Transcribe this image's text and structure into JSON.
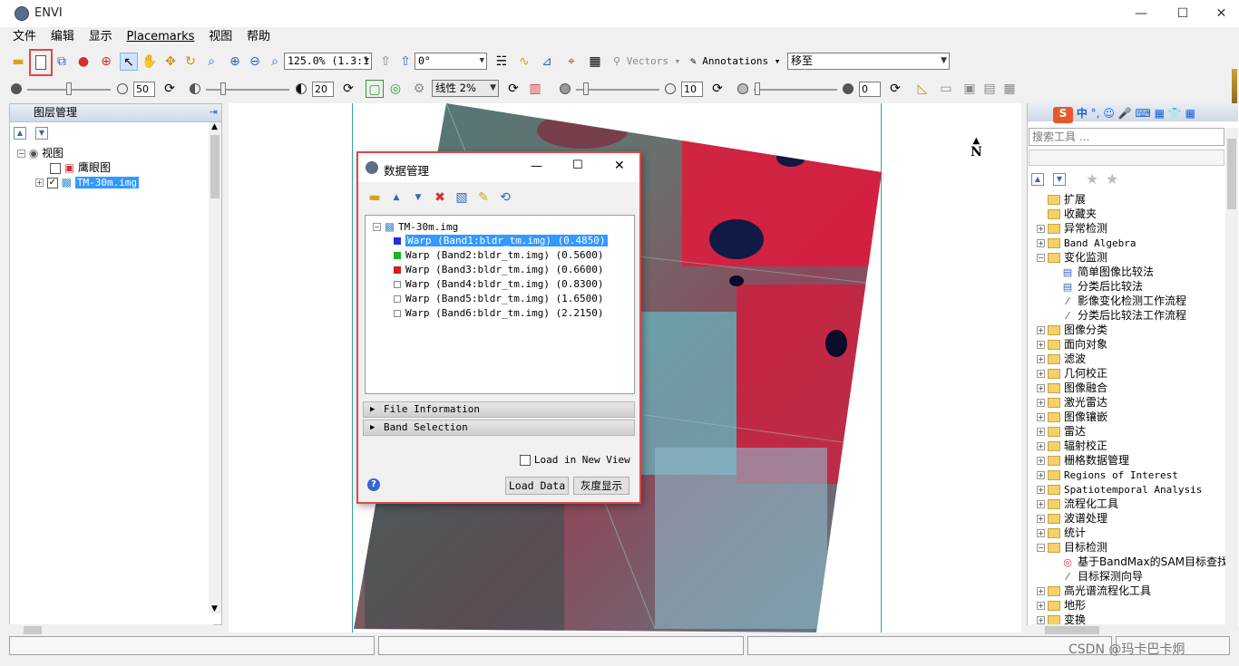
{
  "window": {
    "title": "ENVI"
  },
  "menu": [
    "文件",
    "编辑",
    "显示",
    "Placemarks",
    "视图",
    "帮助"
  ],
  "toolbar": {
    "zoom_value": "125.0% (1.3:1",
    "rotation_value": "0°",
    "vectors_label": "Vectors",
    "annotations_label": "Annotations",
    "goto_value": "移至"
  },
  "toolbar2": {
    "brightness": "50",
    "contrast": "20",
    "stretch": "线性 2%",
    "sharpen": "10",
    "transparency": "0"
  },
  "layer_panel": {
    "title": "图层管理",
    "root": "视图",
    "items": [
      {
        "label": "鹰眼图",
        "checked": false
      },
      {
        "label": "TM-30m.img",
        "checked": true,
        "selected": true
      }
    ]
  },
  "data_manager": {
    "title": "数据管理",
    "file": "TM-30m.img",
    "bands": [
      {
        "label": "Warp (Band1:bldr_tm.img) (0.4850)",
        "color": "#2a2ae0",
        "selected": true
      },
      {
        "label": "Warp (Band2:bldr_tm.img) (0.5600)",
        "color": "#1db51d"
      },
      {
        "label": "Warp (Band3:bldr_tm.img) (0.6600)",
        "color": "#d41c1c"
      },
      {
        "label": "Warp (Band4:bldr_tm.img) (0.8300)",
        "color": "#ffffff"
      },
      {
        "label": "Warp (Band5:bldr_tm.img) (1.6500)",
        "color": "#ffffff"
      },
      {
        "label": "Warp (Band6:bldr_tm.img) (2.2150)",
        "color": "#ffffff"
      }
    ],
    "sections": [
      "File Information",
      "Band Selection"
    ],
    "load_in_new_view": "Load in New View",
    "load_data_button": "Load Data",
    "grayscale_button": "灰度显示"
  },
  "toolbox": {
    "search_placeholder": "搜索工具 ...",
    "items": [
      {
        "label": "扩展",
        "type": "folder"
      },
      {
        "label": "收藏夹",
        "type": "folder"
      },
      {
        "label": "异常检测",
        "type": "folder",
        "exp": "+"
      },
      {
        "label": "Band Algebra",
        "type": "folder",
        "exp": "+"
      },
      {
        "label": "变化监测",
        "type": "folder",
        "exp": "-"
      },
      {
        "label": "简单图像比较法",
        "type": "tool",
        "indent": 1
      },
      {
        "label": "分类后比较法",
        "type": "tool",
        "indent": 1
      },
      {
        "label": "影像变化检测工作流程",
        "type": "wand",
        "indent": 1
      },
      {
        "label": "分类后比较法工作流程",
        "type": "wand",
        "indent": 1
      },
      {
        "label": "图像分类",
        "type": "folder",
        "exp": "+"
      },
      {
        "label": "面向对象",
        "type": "folder",
        "exp": "+"
      },
      {
        "label": "滤波",
        "type": "folder",
        "exp": "+"
      },
      {
        "label": "几何校正",
        "type": "folder",
        "exp": "+"
      },
      {
        "label": "图像融合",
        "type": "folder",
        "exp": "+"
      },
      {
        "label": "激光雷达",
        "type": "folder",
        "exp": "+"
      },
      {
        "label": "图像镶嵌",
        "type": "folder",
        "exp": "+"
      },
      {
        "label": "雷达",
        "type": "folder",
        "exp": "+"
      },
      {
        "label": "辐射校正",
        "type": "folder",
        "exp": "+"
      },
      {
        "label": "栅格数据管理",
        "type": "folder",
        "exp": "+"
      },
      {
        "label": "Regions of Interest",
        "type": "folder",
        "exp": "+"
      },
      {
        "label": "Spatiotemporal Analysis",
        "type": "folder",
        "exp": "+"
      },
      {
        "label": "流程化工具",
        "type": "folder",
        "exp": "+"
      },
      {
        "label": "波谱处理",
        "type": "folder",
        "exp": "+"
      },
      {
        "label": "统计",
        "type": "folder",
        "exp": "+"
      },
      {
        "label": "目标检测",
        "type": "folder",
        "exp": "-"
      },
      {
        "label": "基于BandMax的SAM目标查找向",
        "type": "target",
        "indent": 1
      },
      {
        "label": "目标探测向导",
        "type": "wand",
        "indent": 1
      },
      {
        "label": "高光谱流程化工具",
        "type": "folder",
        "exp": "+"
      },
      {
        "label": "地形",
        "type": "folder",
        "exp": "+"
      },
      {
        "label": "变换",
        "type": "folder",
        "exp": "+"
      }
    ]
  },
  "north_label": "N",
  "watermark": "CSDN @玛卡巴卡炯",
  "colors": {
    "accent_red": "#e04848",
    "selection_blue": "#3399ff"
  }
}
